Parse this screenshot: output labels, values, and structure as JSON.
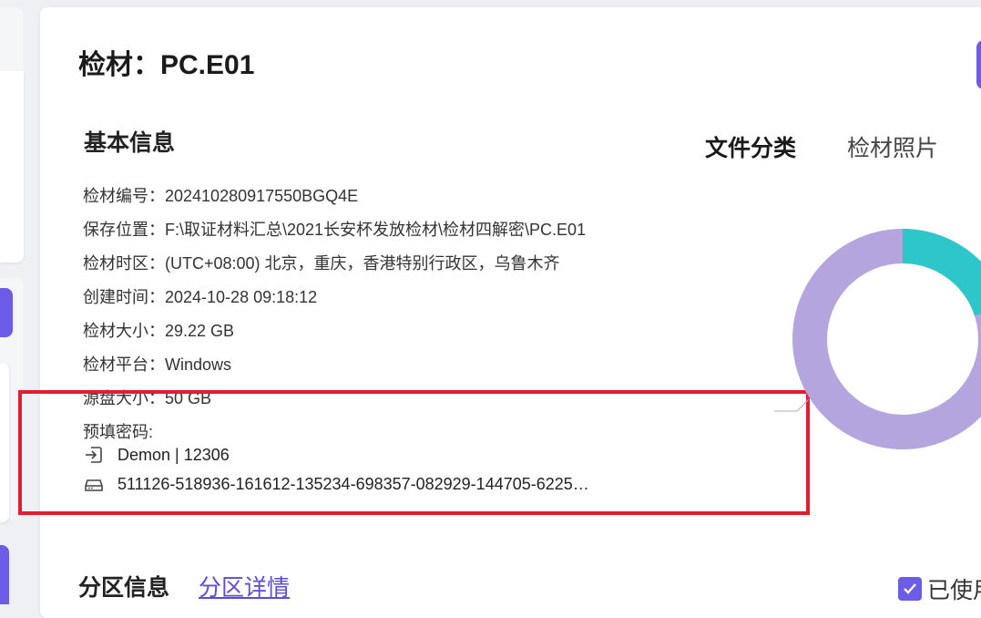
{
  "page": {
    "title": "检材：PC.E01"
  },
  "basic_info": {
    "heading": "基本信息",
    "rows": [
      {
        "label": "检材编号：",
        "value": "202410280917550BGQ4E"
      },
      {
        "label": "保存位置：",
        "value": "F:\\取证材料汇总\\2021长安杯发放检材\\检材四解密\\PC.E01"
      },
      {
        "label": "检材时区：",
        "value": "(UTC+08:00) 北京，重庆，香港特别行政区，乌鲁木齐"
      },
      {
        "label": "创建时间：",
        "value": "2024-10-28 09:18:12"
      },
      {
        "label": "检材大小：",
        "value": "29.22 GB"
      },
      {
        "label": "检材平台：",
        "value": "Windows"
      },
      {
        "label": "源盘大小：",
        "value": "50 GB"
      }
    ],
    "password_label": "预填密码:",
    "passwords": [
      {
        "icon": "login-arrow-icon",
        "text": "Demon | 12306"
      },
      {
        "icon": "drive-icon",
        "text": "511126-518936-161612-135234-698357-082929-144705-6225…"
      }
    ]
  },
  "tabs": {
    "active": "文件分类",
    "inactive": "检材照片"
  },
  "donut": {
    "colors": {
      "primary": "#b4a5de",
      "secondary": "#2ec7c9"
    },
    "fractions": [
      0.8,
      0.2
    ]
  },
  "partition": {
    "heading": "分区信息",
    "link": "分区详情",
    "used_label": "已使用"
  },
  "colors": {
    "accent": "#6c5ce7",
    "highlight": "#e01e2d",
    "link": "#5b4cd8"
  }
}
